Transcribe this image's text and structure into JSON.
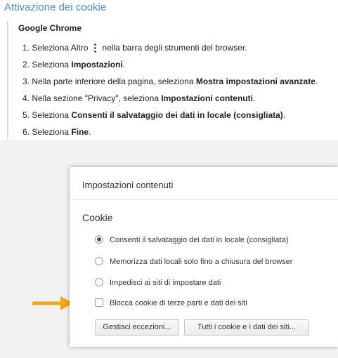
{
  "heading": "Attivazione dei cookie",
  "instructions": {
    "browser": "Google Chrome",
    "steps": [
      {
        "num": "1.",
        "pre": "Seleziona Altro",
        "post": "nella barra degli strumenti del browser.",
        "icon": "kebab-menu-icon"
      },
      {
        "num": "2.",
        "pre": "Seleziona ",
        "bold": "Impostazioni",
        "post": "."
      },
      {
        "num": "3.",
        "pre": "Nella parte inferiore della pagina, seleziona ",
        "bold": "Mostra impostazioni avanzate",
        "post": "."
      },
      {
        "num": "4.",
        "pre": "Nella sezione \"Privacy\", seleziona ",
        "bold": "Impostazioni contenuti",
        "post": "."
      },
      {
        "num": "5.",
        "pre": "Seleziona ",
        "bold": "Consenti il salvataggio dei dati in locale (consigliata)",
        "post": "."
      },
      {
        "num": "6.",
        "pre": "Seleziona ",
        "bold": "Fine",
        "post": "."
      }
    ]
  },
  "dialog": {
    "title": "Impostazioni contenuti",
    "section": "Cookie",
    "options": [
      {
        "type": "radio",
        "label": "Consenti il salvataggio dei dati in locale (consigliata)",
        "checked": true
      },
      {
        "type": "radio",
        "label": "Memorizza dati locali solo fino a chiusura del browser",
        "checked": false
      },
      {
        "type": "radio",
        "label": "Impedisci ai siti di impostare dati",
        "checked": false
      },
      {
        "type": "checkbox",
        "label": "Blocca cookie di terze parti e dati dei siti",
        "checked": false
      }
    ],
    "buttons": {
      "exceptions": "Gestisci eccezioni...",
      "all_cookies": "Tutti i cookie e i dati dei siti..."
    }
  },
  "colors": {
    "heading": "#4a8ac9",
    "arrow": "#f0a51e",
    "backdrop": "#f2f2f2"
  }
}
